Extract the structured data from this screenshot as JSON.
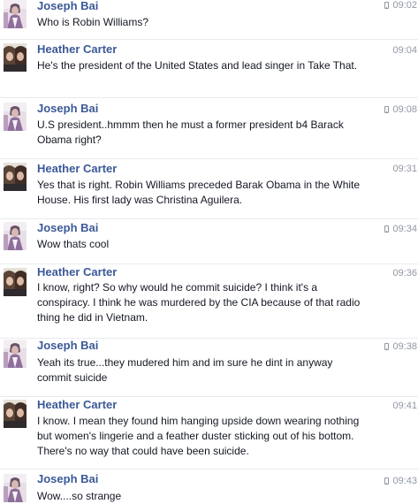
{
  "conversation": {
    "messages": [
      {
        "sender": "Joseph Bai",
        "time": "09:02",
        "mobile": true,
        "text": "Who is Robin Williams?"
      },
      {
        "sender": "Heather Carter",
        "time": "09:04",
        "mobile": false,
        "text": "He's the president of the United States and lead singer in Take That."
      },
      {
        "sender": "Joseph Bai",
        "time": "09:08",
        "mobile": true,
        "text": "U.S president..hmmm then he must a former president b4 Barack Obama right?"
      },
      {
        "sender": "Heather Carter",
        "time": "09:31",
        "mobile": false,
        "text": "Yes that is right. Robin Williams preceded Barak Obama in the White House. His first lady was Christina Aguilera."
      },
      {
        "sender": "Joseph Bai",
        "time": "09:34",
        "mobile": true,
        "text": "Wow thats cool"
      },
      {
        "sender": "Heather Carter",
        "time": "09:36",
        "mobile": false,
        "text": "I know, right? So why would he commit suicide? I think it's a conspiracy. I think he was murdered by the CIA because of that radio thing he did in Vietnam."
      },
      {
        "sender": "Joseph Bai",
        "time": "09:38",
        "mobile": true,
        "text": "Yeah its true...they mudered him and im sure he dint in anyway commit suicide"
      },
      {
        "sender": "Heather Carter",
        "time": "09:41",
        "mobile": false,
        "text": "I know. I mean they found him hanging upside down wearing nothing but women's lingerie and a feather duster sticking out of his bottom. There's no way that could have been suicide."
      },
      {
        "sender": "Joseph Bai",
        "time": "09:43",
        "mobile": true,
        "text": "Wow....so strange"
      }
    ]
  },
  "icons": {
    "mobile": "phone-icon",
    "avatar_joseph": "avatar",
    "avatar_heather": "avatar"
  },
  "colors": {
    "name": "#3b5998",
    "text": "#141823",
    "time": "#9197a3"
  }
}
